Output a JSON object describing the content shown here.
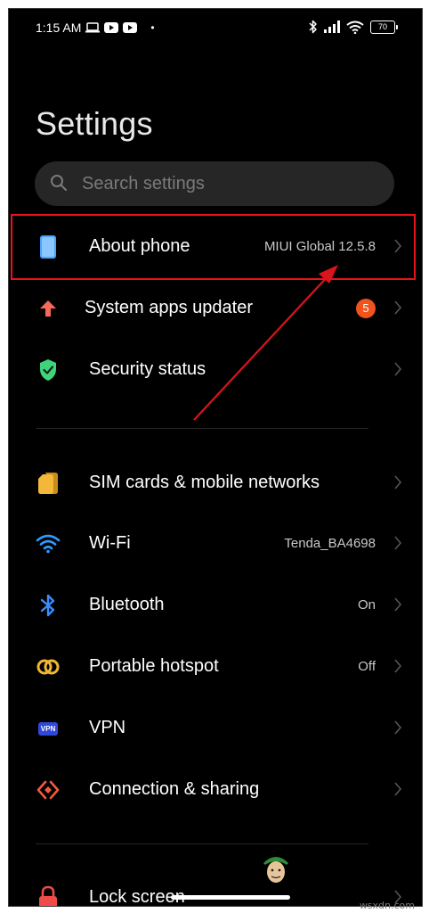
{
  "status_bar": {
    "time": "1:15 AM",
    "dot": "•",
    "battery": "70"
  },
  "page": {
    "title": "Settings"
  },
  "search": {
    "placeholder": "Search settings"
  },
  "groups": [
    {
      "items": [
        {
          "label": "About phone",
          "value": "MIUI Global 12.5.8",
          "icon": "phone-icon"
        },
        {
          "label": "System apps updater",
          "badge": "5",
          "icon": "arrow-up-icon"
        },
        {
          "label": "Security status",
          "icon": "shield-check-icon"
        }
      ]
    },
    {
      "items": [
        {
          "label": "SIM cards & mobile networks",
          "icon": "sim-card-icon"
        },
        {
          "label": "Wi-Fi",
          "value": "Tenda_BA4698",
          "icon": "wifi-icon"
        },
        {
          "label": "Bluetooth",
          "value": "On",
          "icon": "bluetooth-icon"
        },
        {
          "label": "Portable hotspot",
          "value": "Off",
          "icon": "hotspot-icon"
        },
        {
          "label": "VPN",
          "icon": "vpn-icon",
          "icon_text": "VPN"
        },
        {
          "label": "Connection & sharing",
          "icon": "connection-sharing-icon"
        }
      ]
    },
    {
      "items": [
        {
          "label": "Lock screen",
          "icon": "lock-icon"
        }
      ]
    }
  ],
  "watermark": "wsxdn.com",
  "colors": {
    "background": "#000000",
    "highlight": "#e8141c",
    "annotation_arrow": "#d9141c",
    "badge": "#f0531c",
    "security": "#3fd47a",
    "wifi": "#2f9bff",
    "bluetooth": "#3a8dff",
    "hotspot": "#f2b633",
    "sim": "#f4b73a",
    "phone": "#4aa3ff",
    "vpn": "#3048d9",
    "sharing": "#f25a3c",
    "lock": "#f04b4b"
  }
}
